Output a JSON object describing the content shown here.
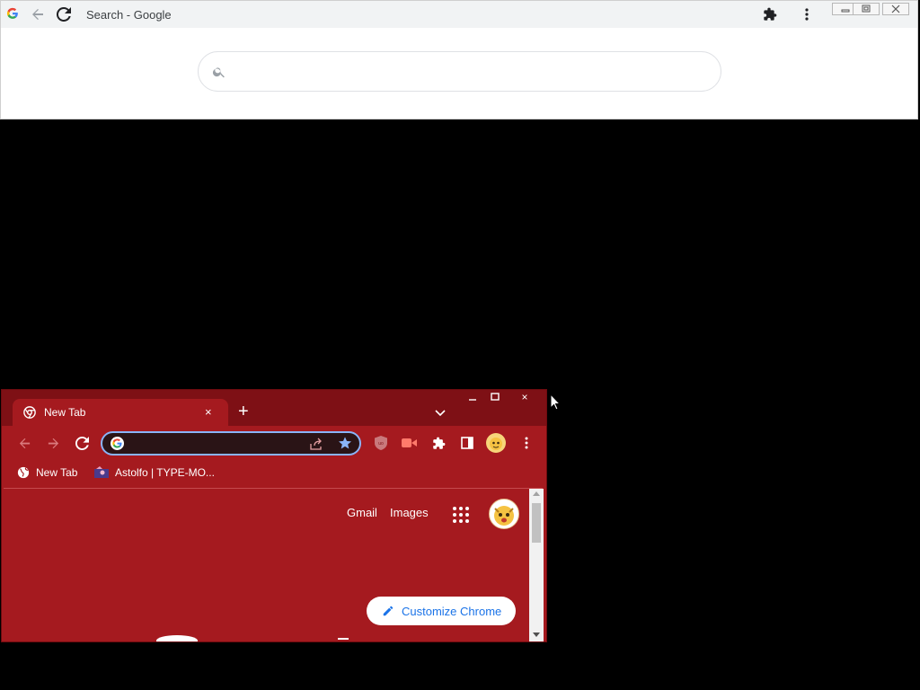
{
  "top_window": {
    "title": "Search - Google",
    "search_placeholder": "",
    "colors": {
      "titlebar": "#f1f3f4",
      "background": "#ffffff"
    }
  },
  "chrome_window": {
    "tab": {
      "title": "New Tab",
      "close_symbol": "×"
    },
    "newtab_symbol": "+",
    "window_controls": {
      "close_symbol": "×"
    },
    "omnibox_value": "",
    "bookmarks": [
      {
        "label": "New Tab",
        "icon": "globe-icon"
      },
      {
        "label": "Astolfo | TYPE-MO...",
        "icon": "bookmark-favicon"
      }
    ],
    "ntp": {
      "gmail_link": "Gmail",
      "images_link": "Images",
      "customize_label": "Customize Chrome"
    },
    "colors": {
      "theme": "#a51a1f",
      "frame": "#7e1015",
      "omnibox_focus": "#8ab4f8",
      "customize_text": "#1a73e8"
    }
  }
}
